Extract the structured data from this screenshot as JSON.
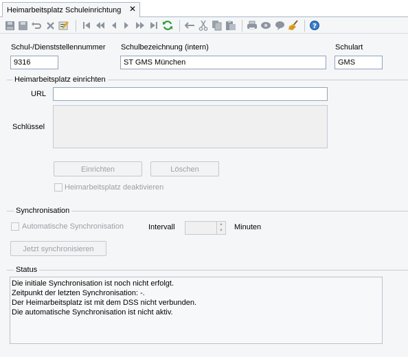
{
  "tab": {
    "title": "Heimarbeitsplatz Schuleinrichtung",
    "close": "✕"
  },
  "toolbar": {
    "icons": [
      "save-all-icon",
      "save-icon",
      "undo-icon",
      "delete-icon",
      "edit-icon",
      "first-record-icon",
      "previous-page-icon",
      "previous-record-icon",
      "next-record-icon",
      "next-page-icon",
      "last-record-icon",
      "refresh-icon",
      "back-icon",
      "cut-icon",
      "copy-icon",
      "paste-icon",
      "print-icon",
      "preview-icon",
      "comment-icon",
      "clean-icon",
      "help-icon"
    ]
  },
  "school": {
    "number_label": "Schul-/Dienststellennummer",
    "number_value": "9316",
    "name_label": "Schulbezeichnung (intern)",
    "name_value": "ST GMS München",
    "type_label": "Schulart",
    "type_value": "GMS"
  },
  "setup": {
    "title": "Heimarbeitsplatz einrichten",
    "url_label": "URL",
    "url_value": "",
    "key_label": "Schlüssel",
    "key_value": "",
    "setup_button": "Einrichten",
    "delete_button": "Löschen",
    "deactivate_label": "Heimarbeitsplatz deaktivieren"
  },
  "sync": {
    "title": "Synchronisation",
    "auto_label": "Automatische Synchronisation",
    "interval_label": "Intervall",
    "interval_value": "",
    "unit_label": "Minuten",
    "sync_now_button": "Jetzt synchronisieren"
  },
  "status": {
    "title": "Status",
    "lines": [
      "Die initiale Synchronisation ist noch nicht erfolgt.",
      "Zeitpunkt der letzten Synchronisation: -.",
      "Der Heimarbeitsplatz ist mit dem DSS nicht verbunden.",
      "Die automatische Synchronisation ist nicht aktiv."
    ]
  },
  "colors": {
    "accent": "#1a5ea8",
    "refresh": "#2e9b3a",
    "border": "#8fa4bc"
  }
}
